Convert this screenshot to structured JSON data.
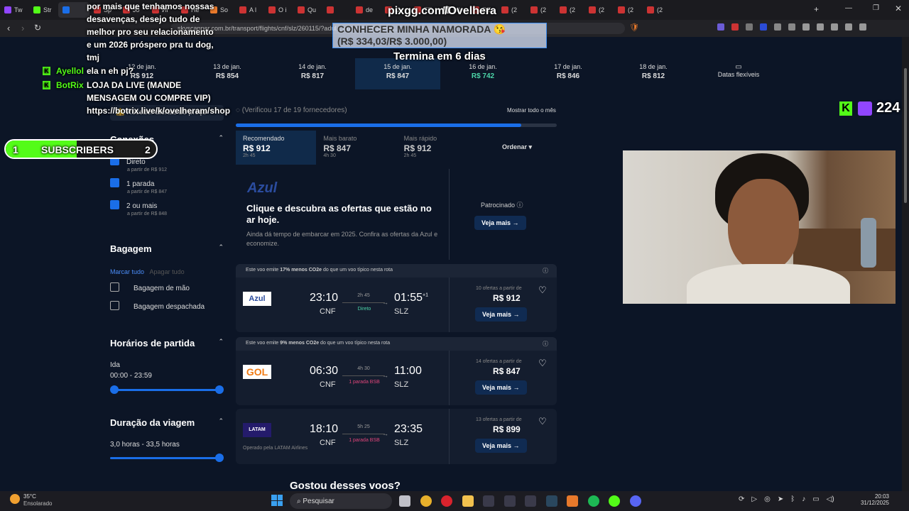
{
  "browser": {
    "tabs": [
      "Tw",
      "Str",
      "",
      "Sp",
      "Jo",
      "Иг",
      "He",
      "So",
      "A l",
      "O i",
      "Qu",
      "",
      "de",
      "(2",
      "TE",
      "(4)",
      "RE",
      "(2",
      "(2",
      "(2",
      "(2",
      "(2",
      "(2"
    ],
    "url": "skyscanner.com.br/transport/flights/cnf/slz/260115/?adul...                                   outboundaltsenab..."
  },
  "dates": [
    {
      "day": "12 de jan.",
      "price": "R$ 912"
    },
    {
      "day": "13 de jan.",
      "price": "R$ 854"
    },
    {
      "day": "14 de jan.",
      "price": "R$ 817"
    },
    {
      "day": "15 de jan.",
      "price": "R$ 847"
    },
    {
      "day": "16 de jan.",
      "price": "R$ 742"
    },
    {
      "day": "17 de jan.",
      "price": "R$ 846"
    },
    {
      "day": "18 de jan.",
      "price": "R$ 812"
    },
    {
      "day": "Datas flexíveis",
      "price": ""
    }
  ],
  "status": {
    "loading": "(Verificou 17 de 19 fornecedores)",
    "show_month": "Mostrar todo o mês",
    "alerts": "Receber alertas de preço"
  },
  "sort_tabs": [
    {
      "label": "Recomendado",
      "price": "R$ 912",
      "dur": "2h 45"
    },
    {
      "label": "Mais barato",
      "price": "R$ 847",
      "dur": "4h 30"
    },
    {
      "label": "Mais rápido",
      "price": "R$ 912",
      "dur": "2h 45"
    }
  ],
  "order": "Ordenar",
  "filters": {
    "connections": {
      "title": "Conexões",
      "items": [
        {
          "label": "Direto",
          "sub": "a partir de R$ 912"
        },
        {
          "label": "1 parada",
          "sub": "a partir de R$ 847"
        },
        {
          "label": "2 ou mais",
          "sub": "a partir de R$ 848"
        }
      ]
    },
    "baggage": {
      "title": "Bagagem",
      "mark_all": "Marcar tudo",
      "clear_all": "Apagar tudo",
      "items": [
        "Bagagem de mão",
        "Bagagem despachada"
      ]
    },
    "departure": {
      "title": "Horários de partida",
      "sub": "Ida",
      "range": "00:00 - 23:59"
    },
    "duration": {
      "title": "Duração da viagem",
      "range": "3,0 horas - 33,5 horas"
    }
  },
  "ad": {
    "brand": "Azul",
    "title": "Clique e descubra as ofertas que estão no ar hoje.",
    "body": "Ainda dá tempo de embarcar em 2025. Confira as ofertas da Azul e economize.",
    "sponsored": "Patrocinado",
    "cta": "Veja mais →"
  },
  "flights": [
    {
      "banner_pre": "Este voo emite ",
      "banner_bold": "17% menos CO2e",
      "banner_post": " do que um voo típico nesta rota",
      "airline": "Azul",
      "dep": "23:10",
      "from": "CNF",
      "dur": "2h 45",
      "stops": "Direto",
      "arr": "01:55",
      "plus": "+1",
      "to": "SLZ",
      "offers": "10 ofertas a partir de",
      "price": "R$ 912",
      "cta": "Veja mais →",
      "operated": ""
    },
    {
      "banner_pre": "Este voo emite ",
      "banner_bold": "9% menos CO2e",
      "banner_post": " do que um voo típico nesta rota",
      "airline": "GOL",
      "dep": "06:30",
      "from": "CNF",
      "dur": "4h 30",
      "stops": "1 parada BSB",
      "arr": "11:00",
      "plus": "",
      "to": "SLZ",
      "offers": "14 ofertas a partir de",
      "price": "R$ 847",
      "cta": "Veja mais →",
      "operated": ""
    },
    {
      "banner_pre": "",
      "banner_bold": "",
      "banner_post": "",
      "airline": "LATAM",
      "dep": "18:10",
      "from": "CNF",
      "dur": "5h 25",
      "stops": "1 parada BSB",
      "arr": "23:35",
      "plus": "",
      "to": "SLZ",
      "offers": "13 ofertas a partir de",
      "price": "R$ 899",
      "cta": "Veja mais →",
      "operated": "Operado pela LATAM Airlines"
    }
  ],
  "bottom_text": "Gostou desses voos?",
  "stream": {
    "header": "pixgg.com/Ovelhera",
    "goal_title": "CONHECER MINHA NAMORADA 😘",
    "goal_value": "(R$ 334,03/R$ 3.000,00)",
    "timer": "Termina em 6 dias",
    "chat": [
      {
        "user": "",
        "msg": "por mais que tenhamos nossas desavenças, desejo tudo de melhor pro seu relacionamento e um 2026 próspero pra tu dog, tmj"
      },
      {
        "user": "Ayellol",
        "msg": "ela n eh pj?"
      },
      {
        "user": "BotRix",
        "msg": "LOJA DA LIVE (MANDE MENSAGEM OU COMPRE VIP) https://botrix.live/k/ovelheram/shop"
      }
    ],
    "subs": {
      "left": "1",
      "label": "SUBSCRIBERS",
      "right": "2"
    },
    "viewers": "224"
  },
  "taskbar": {
    "temp": "35°C",
    "weather": "Ensolarado",
    "search": "Pesquisar",
    "time": "20:03",
    "date": "31/12/2025"
  },
  "colors": {
    "accent": "#1a6ee8",
    "green": "#4cd4a8",
    "kick": "#53fc18",
    "twitch": "#9146ff",
    "pink": "#e0457b"
  }
}
